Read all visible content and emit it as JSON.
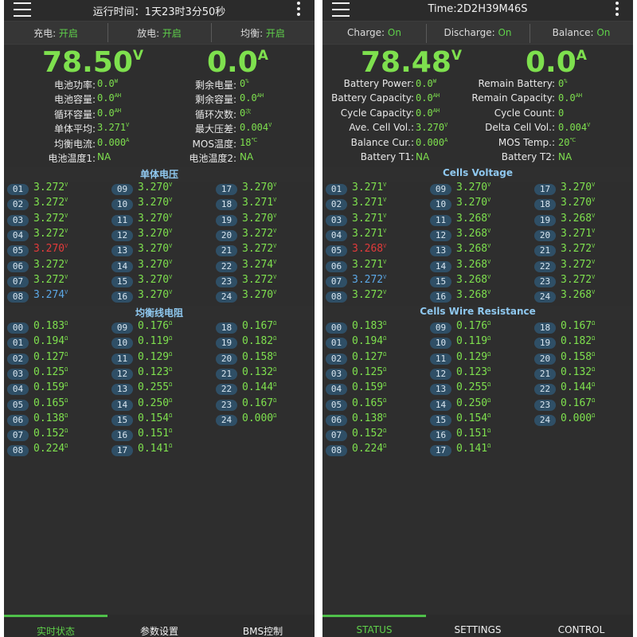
{
  "screens": [
    {
      "id": "cn",
      "title": "运行时间：1天23时3分50秒",
      "switches": [
        {
          "label": "充电: ",
          "value": "开启"
        },
        {
          "label": "放电: ",
          "value": "开启"
        },
        {
          "label": "均衡: ",
          "value": "开启"
        }
      ],
      "voltage": "78.50",
      "voltage_unit": "V",
      "current": "0.0",
      "current_unit": "A",
      "info": [
        [
          {
            "label": "电池功率:",
            "value": "0.0",
            "unit": "W"
          },
          {
            "label": "剩余电量:",
            "value": "0",
            "unit": "%"
          }
        ],
        [
          {
            "label": "电池容量:",
            "value": "0.0",
            "unit": "AH"
          },
          {
            "label": "剩余容量:",
            "value": "0.0",
            "unit": "AH"
          }
        ],
        [
          {
            "label": "循环容量:",
            "value": "0.0",
            "unit": "AH"
          },
          {
            "label": "循环次数:",
            "value": "0",
            "unit": "次"
          }
        ],
        [
          {
            "label": "单体平均:",
            "value": "3.271",
            "unit": "V"
          },
          {
            "label": "最大压差:",
            "value": "0.004",
            "unit": "V"
          }
        ],
        [
          {
            "label": "均衡电流:",
            "value": "0.000",
            "unit": "A"
          },
          {
            "label": "MOS温度:",
            "value": "18",
            "unit": "℃"
          }
        ],
        [
          {
            "label": "电池温度1:",
            "value": "NA",
            "unit": ""
          },
          {
            "label": "电池温度2:",
            "value": "NA",
            "unit": ""
          }
        ]
      ],
      "cells_title": "单体电压",
      "cells": [
        {
          "id": "01",
          "value": "3.272",
          "unit": "V",
          "state": ""
        },
        {
          "id": "02",
          "value": "3.272",
          "unit": "V",
          "state": ""
        },
        {
          "id": "03",
          "value": "3.272",
          "unit": "V",
          "state": ""
        },
        {
          "id": "04",
          "value": "3.272",
          "unit": "V",
          "state": ""
        },
        {
          "id": "05",
          "value": "3.270",
          "unit": "V",
          "state": "red"
        },
        {
          "id": "06",
          "value": "3.272",
          "unit": "V",
          "state": ""
        },
        {
          "id": "07",
          "value": "3.272",
          "unit": "V",
          "state": ""
        },
        {
          "id": "08",
          "value": "3.274",
          "unit": "V",
          "state": "blue"
        },
        {
          "id": "09",
          "value": "3.270",
          "unit": "V",
          "state": ""
        },
        {
          "id": "10",
          "value": "3.270",
          "unit": "V",
          "state": ""
        },
        {
          "id": "11",
          "value": "3.270",
          "unit": "V",
          "state": ""
        },
        {
          "id": "12",
          "value": "3.270",
          "unit": "V",
          "state": ""
        },
        {
          "id": "13",
          "value": "3.270",
          "unit": "V",
          "state": ""
        },
        {
          "id": "14",
          "value": "3.270",
          "unit": "V",
          "state": ""
        },
        {
          "id": "15",
          "value": "3.270",
          "unit": "V",
          "state": ""
        },
        {
          "id": "16",
          "value": "3.270",
          "unit": "V",
          "state": ""
        },
        {
          "id": "17",
          "value": "3.270",
          "unit": "V",
          "state": ""
        },
        {
          "id": "18",
          "value": "3.271",
          "unit": "V",
          "state": ""
        },
        {
          "id": "19",
          "value": "3.270",
          "unit": "V",
          "state": ""
        },
        {
          "id": "20",
          "value": "3.272",
          "unit": "V",
          "state": ""
        },
        {
          "id": "21",
          "value": "3.272",
          "unit": "V",
          "state": ""
        },
        {
          "id": "22",
          "value": "3.274",
          "unit": "V",
          "state": ""
        },
        {
          "id": "23",
          "value": "3.272",
          "unit": "V",
          "state": ""
        },
        {
          "id": "24",
          "value": "3.270",
          "unit": "V",
          "state": ""
        }
      ],
      "res_title": "均衡线电阻",
      "resistances": [
        {
          "id": "00",
          "value": "0.183",
          "unit": "Ω"
        },
        {
          "id": "01",
          "value": "0.194",
          "unit": "Ω"
        },
        {
          "id": "02",
          "value": "0.127",
          "unit": "Ω"
        },
        {
          "id": "03",
          "value": "0.125",
          "unit": "Ω"
        },
        {
          "id": "04",
          "value": "0.159",
          "unit": "Ω"
        },
        {
          "id": "05",
          "value": "0.165",
          "unit": "Ω"
        },
        {
          "id": "06",
          "value": "0.138",
          "unit": "Ω"
        },
        {
          "id": "07",
          "value": "0.152",
          "unit": "Ω"
        },
        {
          "id": "08",
          "value": "0.224",
          "unit": "Ω"
        },
        {
          "id": "09",
          "value": "0.176",
          "unit": "Ω"
        },
        {
          "id": "10",
          "value": "0.119",
          "unit": "Ω"
        },
        {
          "id": "11",
          "value": "0.129",
          "unit": "Ω"
        },
        {
          "id": "12",
          "value": "0.123",
          "unit": "Ω"
        },
        {
          "id": "13",
          "value": "0.255",
          "unit": "Ω"
        },
        {
          "id": "14",
          "value": "0.250",
          "unit": "Ω"
        },
        {
          "id": "15",
          "value": "0.154",
          "unit": "Ω"
        },
        {
          "id": "16",
          "value": "0.151",
          "unit": "Ω"
        },
        {
          "id": "17",
          "value": "0.141",
          "unit": "Ω"
        },
        {
          "id": "18",
          "value": "0.167",
          "unit": "Ω"
        },
        {
          "id": "19",
          "value": "0.182",
          "unit": "Ω"
        },
        {
          "id": "20",
          "value": "0.158",
          "unit": "Ω"
        },
        {
          "id": "21",
          "value": "0.132",
          "unit": "Ω"
        },
        {
          "id": "22",
          "value": "0.144",
          "unit": "Ω"
        },
        {
          "id": "23",
          "value": "0.167",
          "unit": "Ω"
        },
        {
          "id": "24",
          "value": "0.000",
          "unit": "Ω"
        }
      ],
      "tabs": [
        "实时状态",
        "参数设置",
        "BMS控制"
      ]
    },
    {
      "id": "en",
      "title": "Time:2D2H39M46S",
      "switches": [
        {
          "label": "Charge: ",
          "value": "On"
        },
        {
          "label": "Discharge: ",
          "value": "On"
        },
        {
          "label": "Balance: ",
          "value": "On"
        }
      ],
      "voltage": "78.48",
      "voltage_unit": "V",
      "current": "0.0",
      "current_unit": "A",
      "info": [
        [
          {
            "label": "Battery Power:",
            "value": "0.0",
            "unit": "W"
          },
          {
            "label": "Remain Battery:",
            "value": "0",
            "unit": "%"
          }
        ],
        [
          {
            "label": "Battery Capacity:",
            "value": "0.0",
            "unit": "AH"
          },
          {
            "label": "Remain Capacity:",
            "value": "0.0",
            "unit": "AH"
          }
        ],
        [
          {
            "label": "Cycle Capacity:",
            "value": "0.0",
            "unit": "AH"
          },
          {
            "label": "Cycle Count:",
            "value": "0",
            "unit": ""
          }
        ],
        [
          {
            "label": "Ave. Cell Vol.:",
            "value": "3.270",
            "unit": "V"
          },
          {
            "label": "Delta Cell Vol.:",
            "value": "0.004",
            "unit": "V"
          }
        ],
        [
          {
            "label": "Balance Cur.:",
            "value": "0.000",
            "unit": "A"
          },
          {
            "label": "MOS Temp.:",
            "value": "20",
            "unit": "℃"
          }
        ],
        [
          {
            "label": "Battery T1:",
            "value": "NA",
            "unit": ""
          },
          {
            "label": "Battery T2:",
            "value": "NA",
            "unit": ""
          }
        ]
      ],
      "cells_title": "Cells Voltage",
      "cells": [
        {
          "id": "01",
          "value": "3.271",
          "unit": "V",
          "state": ""
        },
        {
          "id": "02",
          "value": "3.271",
          "unit": "V",
          "state": ""
        },
        {
          "id": "03",
          "value": "3.271",
          "unit": "V",
          "state": ""
        },
        {
          "id": "04",
          "value": "3.271",
          "unit": "V",
          "state": ""
        },
        {
          "id": "05",
          "value": "3.268",
          "unit": "V",
          "state": "red"
        },
        {
          "id": "06",
          "value": "3.271",
          "unit": "V",
          "state": ""
        },
        {
          "id": "07",
          "value": "3.272",
          "unit": "V",
          "state": "blue"
        },
        {
          "id": "08",
          "value": "3.272",
          "unit": "V",
          "state": ""
        },
        {
          "id": "09",
          "value": "3.270",
          "unit": "V",
          "state": ""
        },
        {
          "id": "10",
          "value": "3.270",
          "unit": "V",
          "state": ""
        },
        {
          "id": "11",
          "value": "3.268",
          "unit": "V",
          "state": ""
        },
        {
          "id": "12",
          "value": "3.268",
          "unit": "V",
          "state": ""
        },
        {
          "id": "13",
          "value": "3.268",
          "unit": "V",
          "state": ""
        },
        {
          "id": "14",
          "value": "3.268",
          "unit": "V",
          "state": ""
        },
        {
          "id": "15",
          "value": "3.268",
          "unit": "V",
          "state": ""
        },
        {
          "id": "16",
          "value": "3.268",
          "unit": "V",
          "state": ""
        },
        {
          "id": "17",
          "value": "3.270",
          "unit": "V",
          "state": ""
        },
        {
          "id": "18",
          "value": "3.270",
          "unit": "V",
          "state": ""
        },
        {
          "id": "19",
          "value": "3.268",
          "unit": "V",
          "state": ""
        },
        {
          "id": "20",
          "value": "3.271",
          "unit": "V",
          "state": ""
        },
        {
          "id": "21",
          "value": "3.272",
          "unit": "V",
          "state": ""
        },
        {
          "id": "22",
          "value": "3.272",
          "unit": "V",
          "state": ""
        },
        {
          "id": "23",
          "value": "3.272",
          "unit": "V",
          "state": ""
        },
        {
          "id": "24",
          "value": "3.268",
          "unit": "V",
          "state": ""
        }
      ],
      "res_title": "Cells Wire Resistance",
      "resistances": [
        {
          "id": "00",
          "value": "0.183",
          "unit": "Ω"
        },
        {
          "id": "01",
          "value": "0.194",
          "unit": "Ω"
        },
        {
          "id": "02",
          "value": "0.127",
          "unit": "Ω"
        },
        {
          "id": "03",
          "value": "0.125",
          "unit": "Ω"
        },
        {
          "id": "04",
          "value": "0.159",
          "unit": "Ω"
        },
        {
          "id": "05",
          "value": "0.165",
          "unit": "Ω"
        },
        {
          "id": "06",
          "value": "0.138",
          "unit": "Ω"
        },
        {
          "id": "07",
          "value": "0.152",
          "unit": "Ω"
        },
        {
          "id": "08",
          "value": "0.224",
          "unit": "Ω"
        },
        {
          "id": "09",
          "value": "0.176",
          "unit": "Ω"
        },
        {
          "id": "10",
          "value": "0.119",
          "unit": "Ω"
        },
        {
          "id": "11",
          "value": "0.129",
          "unit": "Ω"
        },
        {
          "id": "12",
          "value": "0.123",
          "unit": "Ω"
        },
        {
          "id": "13",
          "value": "0.255",
          "unit": "Ω"
        },
        {
          "id": "14",
          "value": "0.250",
          "unit": "Ω"
        },
        {
          "id": "15",
          "value": "0.154",
          "unit": "Ω"
        },
        {
          "id": "16",
          "value": "0.151",
          "unit": "Ω"
        },
        {
          "id": "17",
          "value": "0.141",
          "unit": "Ω"
        },
        {
          "id": "18",
          "value": "0.167",
          "unit": "Ω"
        },
        {
          "id": "19",
          "value": "0.182",
          "unit": "Ω"
        },
        {
          "id": "20",
          "value": "0.158",
          "unit": "Ω"
        },
        {
          "id": "21",
          "value": "0.132",
          "unit": "Ω"
        },
        {
          "id": "22",
          "value": "0.144",
          "unit": "Ω"
        },
        {
          "id": "23",
          "value": "0.167",
          "unit": "Ω"
        },
        {
          "id": "24",
          "value": "0.000",
          "unit": "Ω"
        }
      ],
      "tabs": [
        "STATUS",
        "SETTINGS",
        "CONTROL"
      ]
    }
  ],
  "colors": {
    "value_green": "#7ee04e",
    "tab_active": "#5fd14a",
    "section_title": "#8fc8ef",
    "cell_low": "#e23a3a",
    "cell_high": "#5ca8e6",
    "background": "#2e2e2e"
  }
}
